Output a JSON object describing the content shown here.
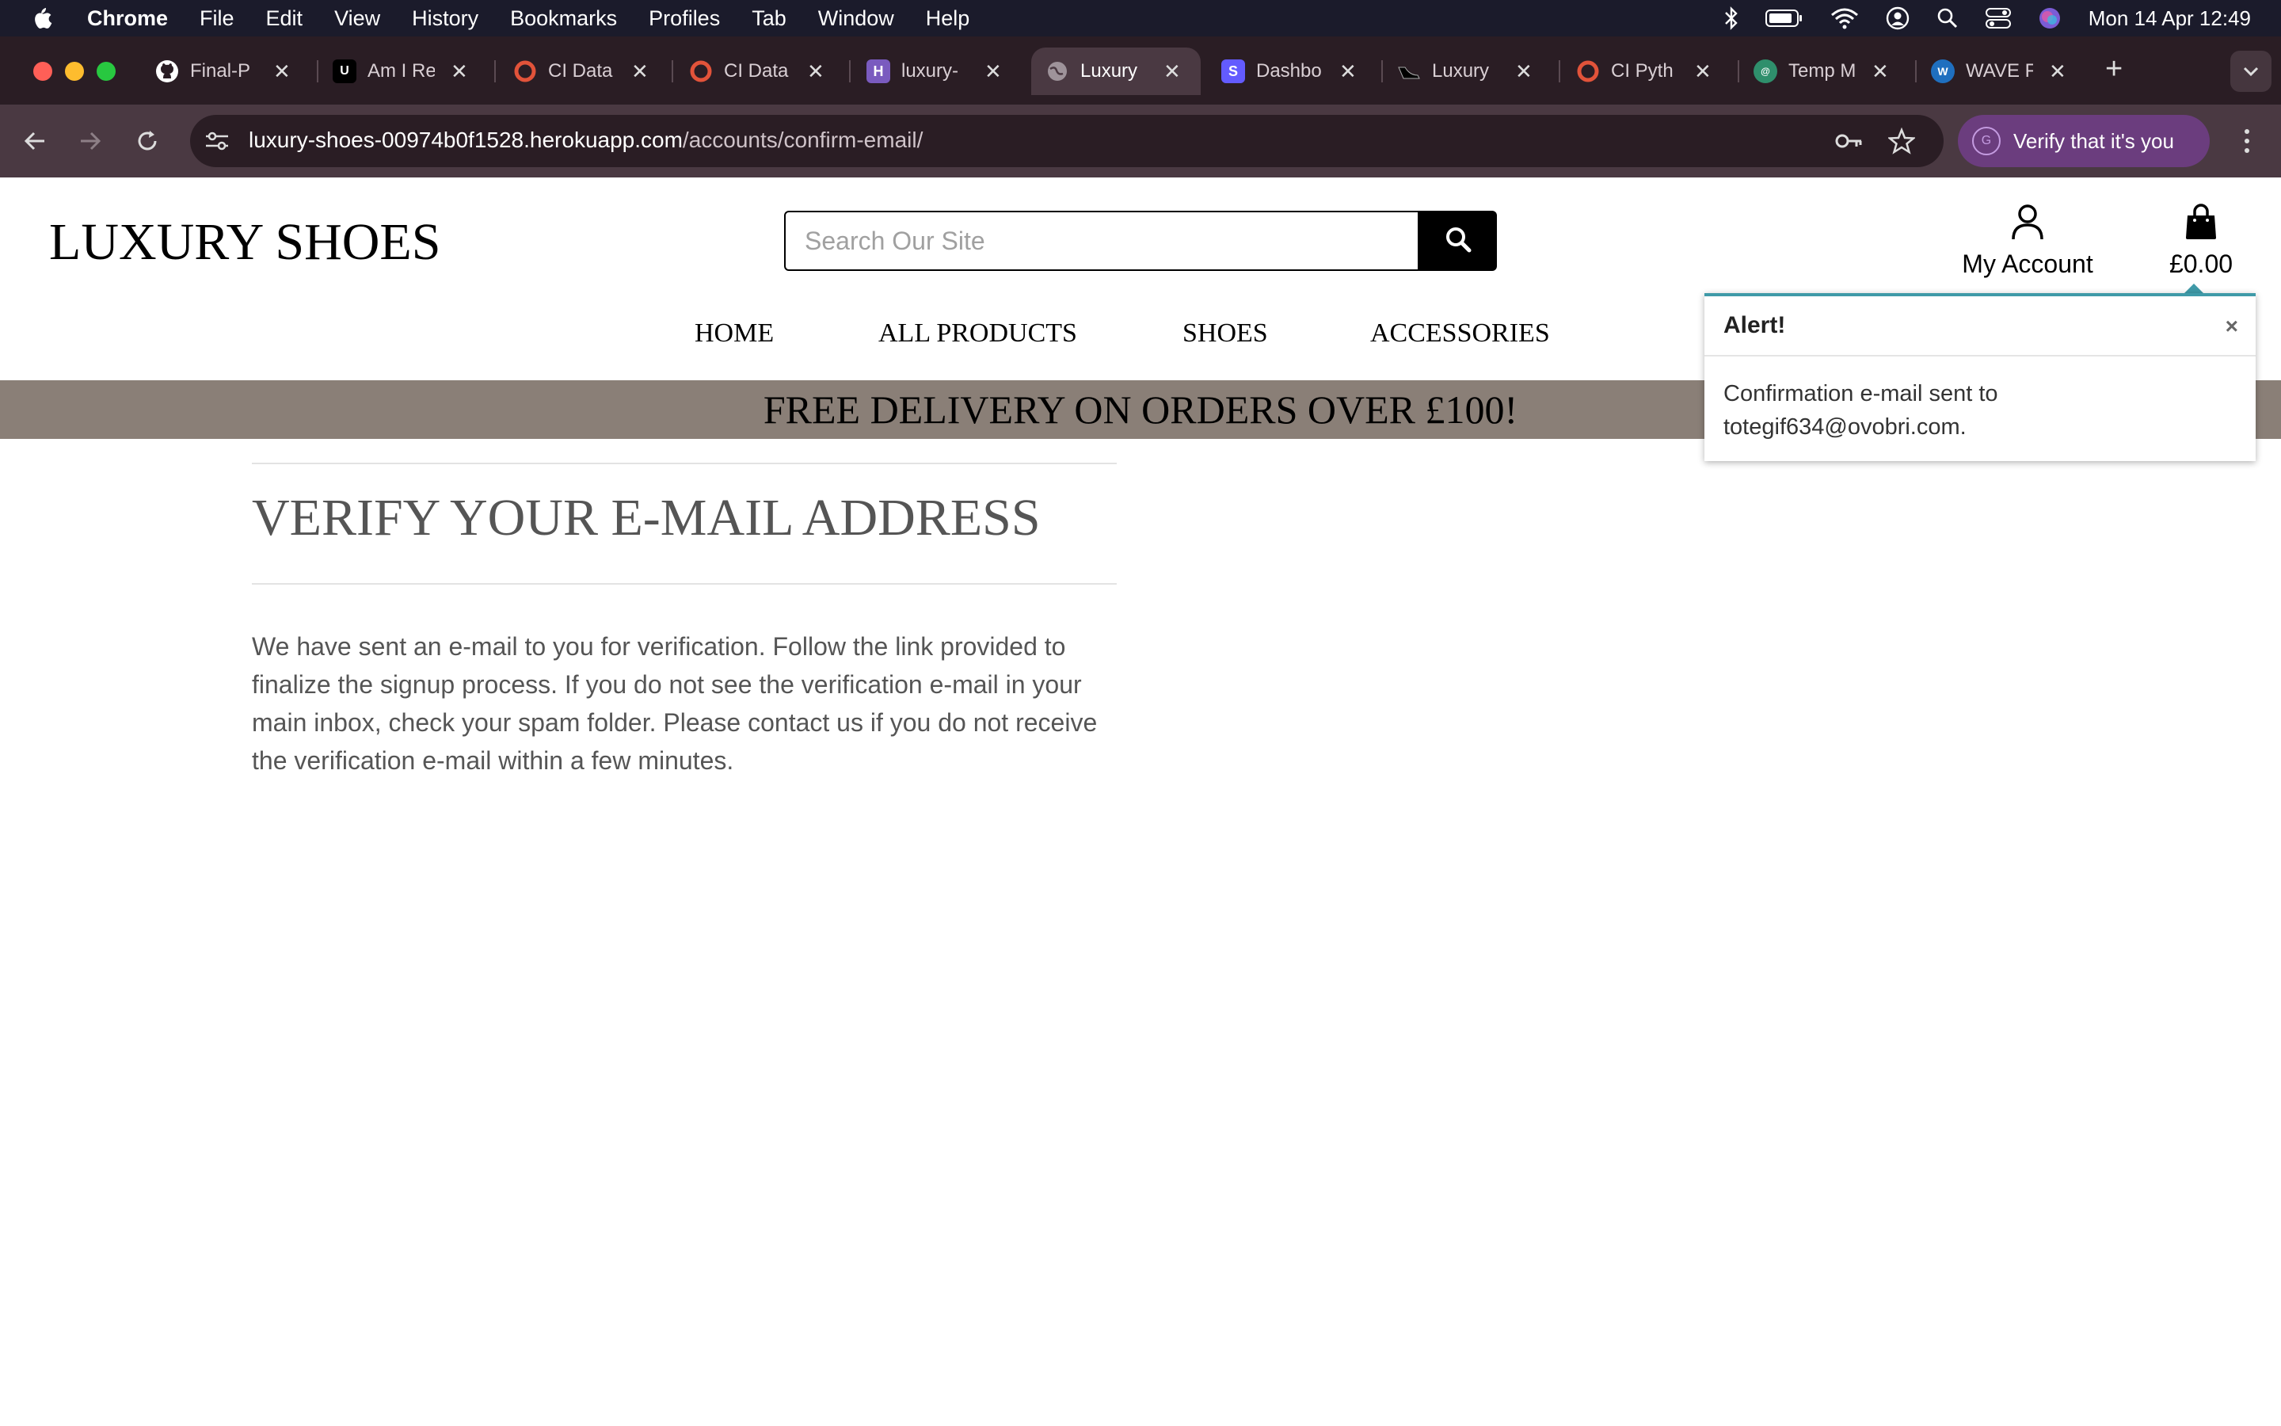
{
  "menubar": {
    "app_name": "Chrome",
    "items": [
      "File",
      "Edit",
      "View",
      "History",
      "Bookmarks",
      "Profiles",
      "Tab",
      "Window",
      "Help"
    ],
    "clock": "Mon 14 Apr  12:49"
  },
  "tabs": [
    {
      "title": "Final-P",
      "icon": "github-icon"
    },
    {
      "title": "Am I Re",
      "icon": "ui-dev-icon"
    },
    {
      "title": "CI Data",
      "icon": "ci-icon"
    },
    {
      "title": "CI Data",
      "icon": "ci-icon"
    },
    {
      "title": "luxury-",
      "icon": "heroku-icon"
    },
    {
      "title": "Luxury",
      "icon": "globe-icon",
      "active": true
    },
    {
      "title": "Dashbo",
      "icon": "stripe-icon"
    },
    {
      "title": "Luxury",
      "icon": "shoe-icon"
    },
    {
      "title": "CI Pyth",
      "icon": "ci-icon"
    },
    {
      "title": "Temp M",
      "icon": "temp-mail-icon"
    },
    {
      "title": "WAVE F",
      "icon": "wave-icon"
    }
  ],
  "omnibox": {
    "domain": "luxury-shoes-00974b0f1528.herokuapp.com",
    "path": "/accounts/confirm-email/"
  },
  "profile_pill": {
    "label": "Verify that it's you",
    "initial": "G"
  },
  "site": {
    "logo": "LUXURY SHOES",
    "search_placeholder": "Search Our Site",
    "account_label": "My Account",
    "cart_total": "£0.00",
    "nav": [
      "HOME",
      "ALL PRODUCTS",
      "SHOES",
      "ACCESSORIES"
    ],
    "banner": "FREE DELIVERY ON ORDERS OVER £100!"
  },
  "content": {
    "heading": "VERIFY YOUR E-MAIL ADDRESS",
    "body": "We have sent an e-mail to you for verification. Follow the link provided to finalize the signup process. If you do not see the verification e-mail in your main inbox, check your spam folder. Please contact us if you do not receive the verification e-mail within a few minutes."
  },
  "alert": {
    "title": "Alert!",
    "close": "×",
    "message": "Confirmation e-mail sent to totegif634@ovobri.com."
  },
  "colors": {
    "menubar": "#1b1b2b",
    "tabstrip": "#2a1d24",
    "toolbar": "#4a3942",
    "banner": "#8a7f77",
    "alert_accent": "#3f9aa8",
    "profile_pill": "#6b3d7e"
  }
}
